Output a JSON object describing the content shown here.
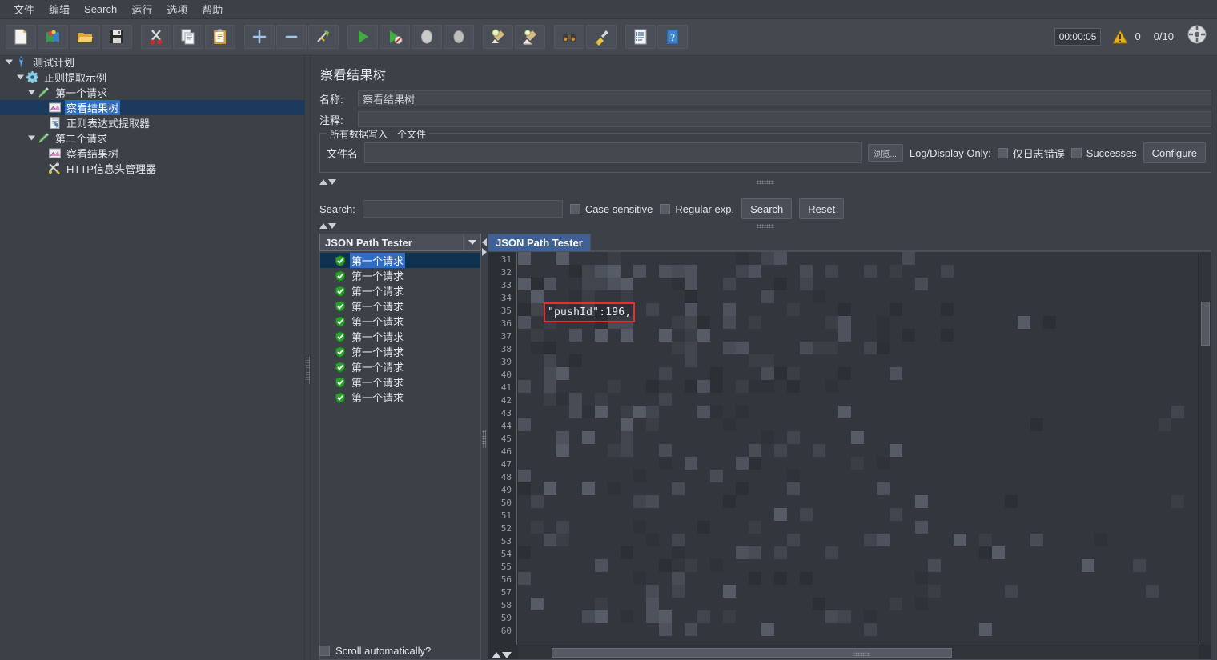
{
  "menubar": {
    "items": [
      {
        "label": "文件",
        "icon": "menu-file"
      },
      {
        "label": "编辑",
        "icon": "menu-edit"
      },
      {
        "label": "Search",
        "icon": "menu-search"
      },
      {
        "label": "运行",
        "icon": "menu-run"
      },
      {
        "label": "选项",
        "icon": "menu-options"
      },
      {
        "label": "帮助",
        "icon": "menu-help"
      }
    ]
  },
  "toolbar": {
    "buttons": [
      {
        "name": "new-icon",
        "title": "New"
      },
      {
        "name": "templates-icon",
        "title": "Templates"
      },
      {
        "name": "open-icon",
        "title": "Open"
      },
      {
        "name": "save-icon",
        "title": "Save"
      },
      {
        "name": "cut-icon",
        "title": "Cut"
      },
      {
        "name": "copy-icon",
        "title": "Copy"
      },
      {
        "name": "paste-icon",
        "title": "Paste"
      },
      {
        "name": "expand-all-icon",
        "title": "Expand"
      },
      {
        "name": "collapse-all-icon",
        "title": "Collapse"
      },
      {
        "name": "toggle-icon",
        "title": "Toggle"
      },
      {
        "name": "start-icon",
        "title": "Start"
      },
      {
        "name": "start-no-timers-icon",
        "title": "Start no pauses"
      },
      {
        "name": "stop-icon",
        "title": "Stop"
      },
      {
        "name": "shutdown-icon",
        "title": "Shutdown"
      },
      {
        "name": "clear-icon",
        "title": "Clear"
      },
      {
        "name": "clear-all-icon",
        "title": "Clear All"
      },
      {
        "name": "search-icon",
        "title": "Search"
      },
      {
        "name": "search-reset-icon",
        "title": "Reset Search"
      },
      {
        "name": "function-helper-icon",
        "title": "Function Helper"
      },
      {
        "name": "help-icon",
        "title": "Help"
      }
    ],
    "timer": "00:00:05",
    "warning_count": "0",
    "thread_count": "0/10"
  },
  "tree": {
    "nodes": [
      {
        "label": "测试计划",
        "icon": "test-plan-icon",
        "depth": 0,
        "toggle": "open",
        "selected": false
      },
      {
        "label": "正则提取示例",
        "icon": "thread-group-icon",
        "depth": 1,
        "toggle": "open",
        "selected": false
      },
      {
        "label": "第一个请求",
        "icon": "http-sampler-icon",
        "depth": 2,
        "toggle": "open",
        "selected": false
      },
      {
        "label": "察看结果树",
        "icon": "view-results-tree-icon",
        "depth": 3,
        "toggle": "none",
        "selected": true
      },
      {
        "label": "正则表达式提取器",
        "icon": "regex-extractor-icon",
        "depth": 3,
        "toggle": "none",
        "selected": false
      },
      {
        "label": "第二个请求",
        "icon": "http-sampler-icon",
        "depth": 2,
        "toggle": "open",
        "selected": false
      },
      {
        "label": "察看结果树",
        "icon": "view-results-tree-icon",
        "depth": 3,
        "toggle": "none",
        "selected": false
      },
      {
        "label": "HTTP信息头管理器",
        "icon": "header-manager-icon",
        "depth": 3,
        "toggle": "none",
        "selected": false
      }
    ]
  },
  "panel": {
    "title": "察看结果树",
    "name_label": "名称:",
    "name_value": "察看结果树",
    "comment_label": "注释:",
    "comment_value": "",
    "filegroup": {
      "title": "所有数据写入一个文件",
      "filename_label": "文件名",
      "filename_value": "",
      "browse_label": "浏览...",
      "log_display_label": "Log/Display Only:",
      "errors_only_label": "仅日志错误",
      "errors_only_checked": false,
      "successes_label": "Successes",
      "successes_checked": false,
      "configure_label": "Configure"
    },
    "search": {
      "label": "Search:",
      "value": "",
      "case_sensitive_label": "Case sensitive",
      "case_sensitive_checked": false,
      "regular_exp_label": "Regular exp.",
      "regular_exp_checked": false,
      "search_button": "Search",
      "reset_button": "Reset"
    },
    "results": {
      "renderer_selected": "JSON Path Tester",
      "items": [
        {
          "label": "第一个请求",
          "status": "success",
          "selected": true
        },
        {
          "label": "第一个请求",
          "status": "success",
          "selected": false
        },
        {
          "label": "第一个请求",
          "status": "success",
          "selected": false
        },
        {
          "label": "第一个请求",
          "status": "success",
          "selected": false
        },
        {
          "label": "第一个请求",
          "status": "success",
          "selected": false
        },
        {
          "label": "第一个请求",
          "status": "success",
          "selected": false
        },
        {
          "label": "第一个请求",
          "status": "success",
          "selected": false
        },
        {
          "label": "第一个请求",
          "status": "success",
          "selected": false
        },
        {
          "label": "第一个请求",
          "status": "success",
          "selected": false
        },
        {
          "label": "第一个请求",
          "status": "success",
          "selected": false
        }
      ],
      "scroll_automatically_label": "Scroll automatically?",
      "scroll_automatically_checked": false
    },
    "viewer": {
      "tab_label": "JSON Path Tester",
      "first_line_number": 31,
      "last_line_number": 60,
      "highlighted_text": "\"pushId\":196,"
    }
  },
  "colors": {
    "window_bg": "#3c4047",
    "toolbar_bg": "#44484f",
    "tree_selection": "#1b3a5c",
    "text_selection": "#2f6cc4",
    "tab_active": "#3f6196",
    "annotation_red": "#ef2b2b",
    "code_bg": "#33363c",
    "gutter_bg": "#2b2e33"
  }
}
